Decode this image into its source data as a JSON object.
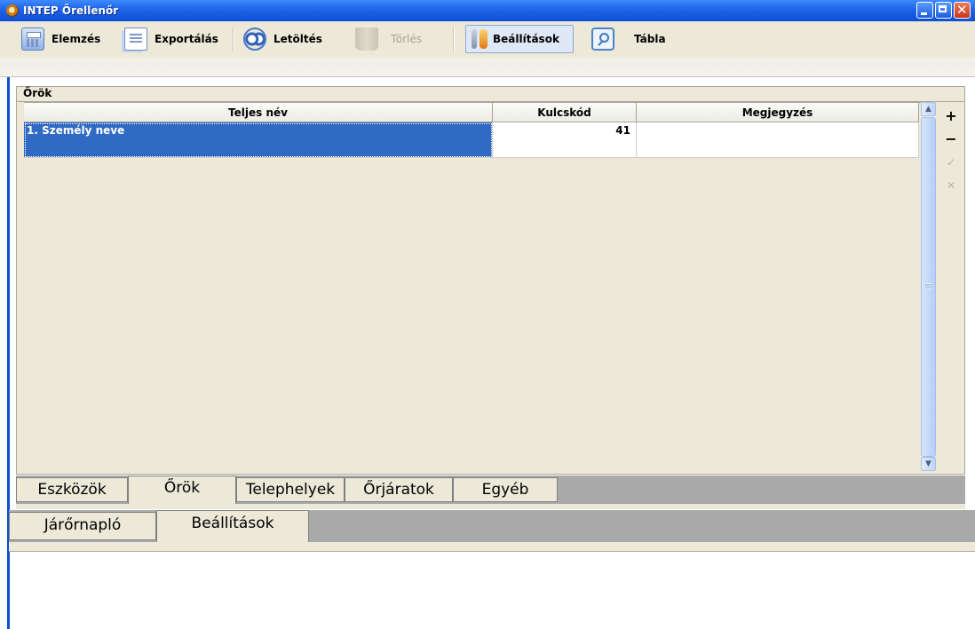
{
  "window": {
    "title": "INTEP Őrellenőr",
    "titlebar_color": "#1f63e6",
    "controls": [
      "minimize",
      "maximize",
      "close"
    ]
  },
  "toolbar": {
    "items": [
      {
        "label": "Elemzés",
        "icon": "calculator-icon",
        "enabled": true,
        "active": false
      },
      {
        "label": "Exportálás",
        "icon": "document-icon",
        "enabled": true,
        "active": false
      },
      {
        "label": "Letöltés",
        "icon": "camera-icon",
        "enabled": true,
        "active": false
      },
      {
        "label": "Törlés",
        "icon": "trash-icon",
        "enabled": false,
        "active": false
      },
      {
        "label": "Beállítások",
        "icon": "tools-icon",
        "enabled": true,
        "active": true
      },
      {
        "label": "Tábla",
        "icon": "magnifier-icon",
        "enabled": true,
        "active": false
      }
    ]
  },
  "panel": {
    "title": "Őrök",
    "columns": [
      "Teljes név",
      "Kulcskód",
      "Megjegyzés"
    ],
    "rows": [
      {
        "name": "1. Személy neve",
        "key": "41",
        "note": "",
        "selected": true
      }
    ],
    "side_actions": [
      {
        "label": "+",
        "icon": "add-icon",
        "enabled": true
      },
      {
        "label": "−",
        "icon": "remove-icon",
        "enabled": true
      },
      {
        "label": "✓",
        "icon": "confirm-icon",
        "enabled": false
      },
      {
        "label": "✕",
        "icon": "cancel-icon",
        "enabled": false
      }
    ],
    "selection_color": "#316ac5"
  },
  "tabs_top": {
    "items": [
      "Eszközök",
      "Őrök",
      "Telephelyek",
      "Őrjáratok",
      "Egyéb"
    ],
    "selected": "Őrök"
  },
  "tabs_bottom": {
    "items": [
      "Járőrnapló",
      "Beállítások"
    ],
    "selected": "Beállítások"
  }
}
